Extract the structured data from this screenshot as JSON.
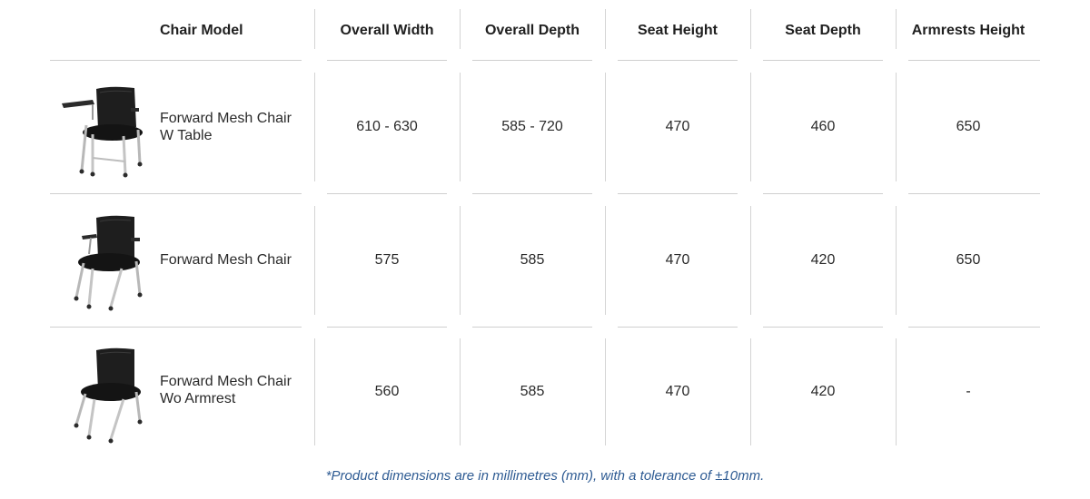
{
  "headers": {
    "model": "Chair Model",
    "overall_width": "Overall Width",
    "overall_depth": "Overall Depth",
    "seat_height": "Seat Height",
    "seat_depth": "Seat Depth",
    "armrests_height": "Armrests Height"
  },
  "rows": [
    {
      "name_line1": "Forward Mesh Chair",
      "name_line2": "W Table",
      "image_icon": "mesh-chair-with-tablet-icon",
      "overall_width": "610 - 630",
      "overall_depth": "585 - 720",
      "seat_height": "470",
      "seat_depth": "460",
      "armrests_height": "650"
    },
    {
      "name_line1": "Forward Mesh Chair",
      "name_line2": "",
      "image_icon": "mesh-chair-with-armrests-icon",
      "overall_width": "575",
      "overall_depth": "585",
      "seat_height": "470",
      "seat_depth": "420",
      "armrests_height": "650"
    },
    {
      "name_line1": "Forward Mesh Chair",
      "name_line2": "Wo Armrest",
      "image_icon": "mesh-chair-no-armrest-icon",
      "overall_width": "560",
      "overall_depth": "585",
      "seat_height": "470",
      "seat_depth": "420",
      "armrests_height": "-"
    }
  ],
  "footnote": "*Product dimensions are in millimetres (mm), with a tolerance of ±10mm.",
  "colors": {
    "footnote": "#2e5b93",
    "divider": "#d4d4d4",
    "text": "#2a2a2a"
  }
}
